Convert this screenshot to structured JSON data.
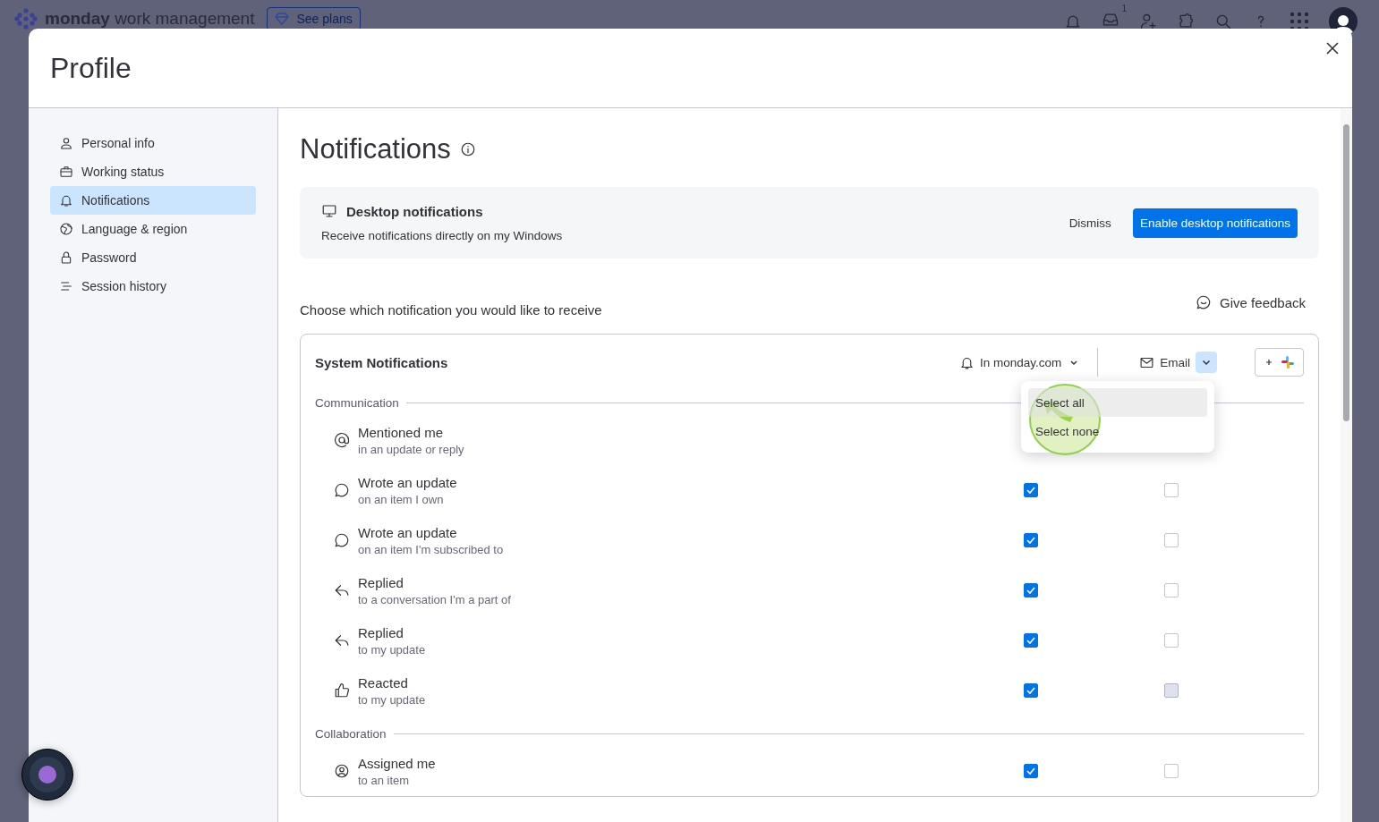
{
  "app_bar": {
    "brand": "monday",
    "product": "work management",
    "plans_button": "See plans",
    "inbox_badge": "1"
  },
  "dialog": {
    "title": "Profile",
    "sidebar": [
      {
        "label": "Personal info",
        "kind": "person",
        "selected": false
      },
      {
        "label": "Working status",
        "kind": "briefcase",
        "selected": false
      },
      {
        "label": "Notifications",
        "kind": "bell",
        "selected": true
      },
      {
        "label": "Language & region",
        "kind": "globe",
        "selected": false
      },
      {
        "label": "Password",
        "kind": "lock",
        "selected": false
      },
      {
        "label": "Session history",
        "kind": "list",
        "selected": false
      }
    ],
    "heading": "Notifications",
    "banner": {
      "title": "Desktop notifications",
      "text": "Receive notifications directly on my Windows",
      "dismiss": "Dismiss",
      "enable": "Enable desktop notifications"
    },
    "intro": "Choose which notification you would like to receive",
    "feedback": "Give feedback",
    "card": {
      "title": "System Notifications",
      "in_app": "In monday.com",
      "email": "Email",
      "email_menu_open": true,
      "menu": [
        {
          "label": "Select all",
          "selected": true
        },
        {
          "label": "Select none",
          "selected": false
        }
      ],
      "sections": [
        {
          "title": "Communication",
          "rows": [
            {
              "kind": "mention",
              "title": "Mentioned me",
              "subtitle": "in an update or reply"
            },
            {
              "kind": "comment",
              "title": "Wrote an update",
              "subtitle": "on an item I own",
              "in_app": {
                "checked": true
              },
              "email": {
                "checked": false,
                "hovered": false
              }
            },
            {
              "kind": "comment",
              "title": "Wrote an update",
              "subtitle": "on an item I'm subscribed to",
              "in_app": {
                "checked": true
              },
              "email": {
                "checked": false,
                "hovered": false
              }
            },
            {
              "kind": "reply",
              "title": "Replied",
              "subtitle": "to a conversation I'm a part of",
              "in_app": {
                "checked": true
              },
              "email": {
                "checked": false,
                "hovered": false
              }
            },
            {
              "kind": "reply",
              "title": "Replied",
              "subtitle": "to my update",
              "in_app": {
                "checked": true
              },
              "email": {
                "checked": false,
                "hovered": false
              }
            },
            {
              "kind": "like",
              "title": "Reacted",
              "subtitle": "to my update",
              "in_app": {
                "checked": true
              },
              "email": {
                "checked": false,
                "hovered": true
              }
            }
          ]
        },
        {
          "title": "Collaboration",
          "rows": [
            {
              "kind": "assign",
              "title": "Assigned me",
              "subtitle": "to an item",
              "in_app": {
                "checked": true
              },
              "email": {
                "checked": false,
                "hovered": false
              }
            }
          ]
        }
      ]
    }
  }
}
